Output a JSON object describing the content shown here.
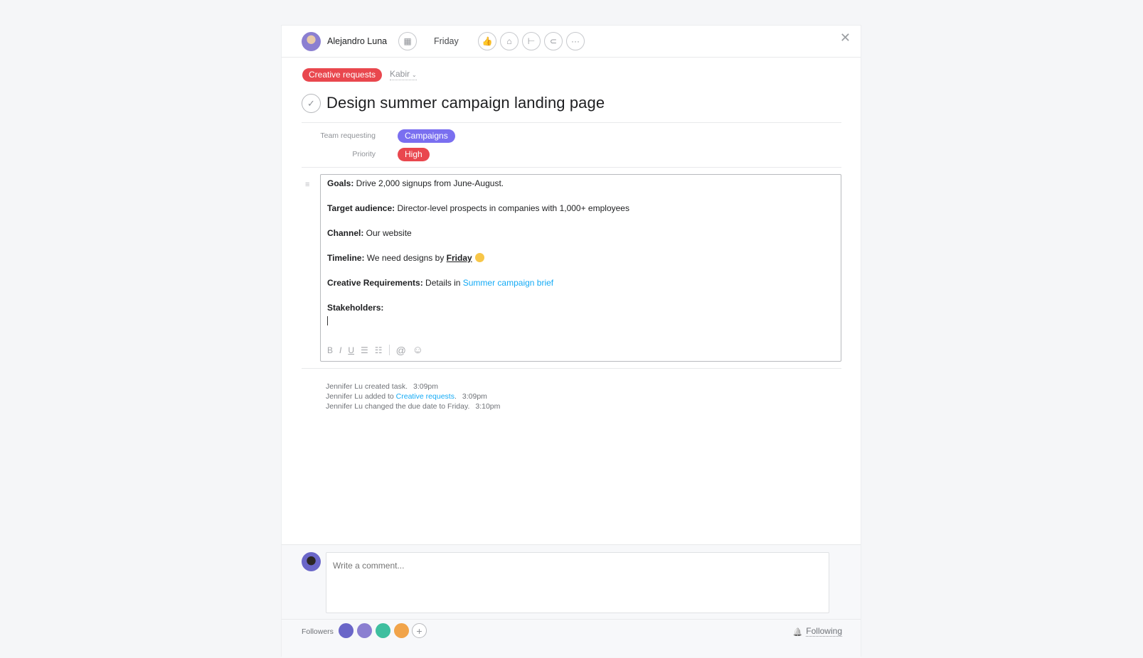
{
  "header": {
    "assignee": "Alejandro Luna",
    "due_date": "Friday",
    "actions": [
      {
        "name": "like-icon",
        "glyph": "👍"
      },
      {
        "name": "tag-icon",
        "glyph": "⌂"
      },
      {
        "name": "subtask-icon",
        "glyph": "⊢"
      },
      {
        "name": "attachment-icon",
        "glyph": "⊂"
      },
      {
        "name": "more-icon",
        "glyph": "···"
      }
    ],
    "close_glyph": "✕",
    "calendar_glyph": "▦"
  },
  "project": {
    "name": "Creative requests",
    "section": "Kabir",
    "section_chevron": "⌄",
    "color": "#e9474e"
  },
  "task": {
    "title": "Design summer campaign landing page",
    "check_glyph": "✓"
  },
  "fields": [
    {
      "label": "Team requesting",
      "value": "Campaigns",
      "color": "#7a6ff0"
    },
    {
      "label": "Priority",
      "value": "High",
      "color": "#e9474e"
    }
  ],
  "description": {
    "icon_glyph": "≡",
    "lines": [
      {
        "label": "Goals:",
        "text": " Drive 2,000 signups from June-August."
      },
      {
        "label": "Target audience:",
        "text": " Director-level prospects in companies with 1,000+ employees"
      },
      {
        "label": "Channel:",
        "text": " Our website"
      },
      {
        "label": "Timeline:",
        "text": " We need designs by ",
        "emphasis": "Friday"
      },
      {
        "label": "Creative Requirements:",
        "text": " Details in ",
        "link": "Summer campaign brief"
      },
      {
        "label": "Stakeholders:",
        "text": ""
      }
    ],
    "toolbar": [
      {
        "name": "bold-icon",
        "glyph": "B"
      },
      {
        "name": "italic-icon",
        "glyph": "I"
      },
      {
        "name": "underline-icon",
        "glyph": "U"
      },
      {
        "name": "bullet-list-icon",
        "glyph": "☰"
      },
      {
        "name": "numbered-list-icon",
        "glyph": "☷"
      },
      {
        "name": "mention-icon",
        "glyph": "@"
      },
      {
        "name": "emoji-icon",
        "glyph": "☺"
      }
    ]
  },
  "activity": [
    {
      "text": "Jennifer Lu created task.",
      "time": "3:09pm"
    },
    {
      "text": "Jennifer Lu added to ",
      "link": "Creative requests",
      "suffix": ".",
      "time": "3:09pm"
    },
    {
      "text": "Jennifer Lu changed the due date to Friday.",
      "time": "3:10pm"
    }
  ],
  "comment": {
    "placeholder": "Write a comment..."
  },
  "followers": {
    "label": "Followers",
    "avatar_colors": [
      "#6a66c8",
      "#8b7fd1",
      "#3fbf9f",
      "#f1a44a"
    ],
    "add_glyph": "+",
    "following_label": "Following",
    "bell_glyph": "🔔"
  }
}
